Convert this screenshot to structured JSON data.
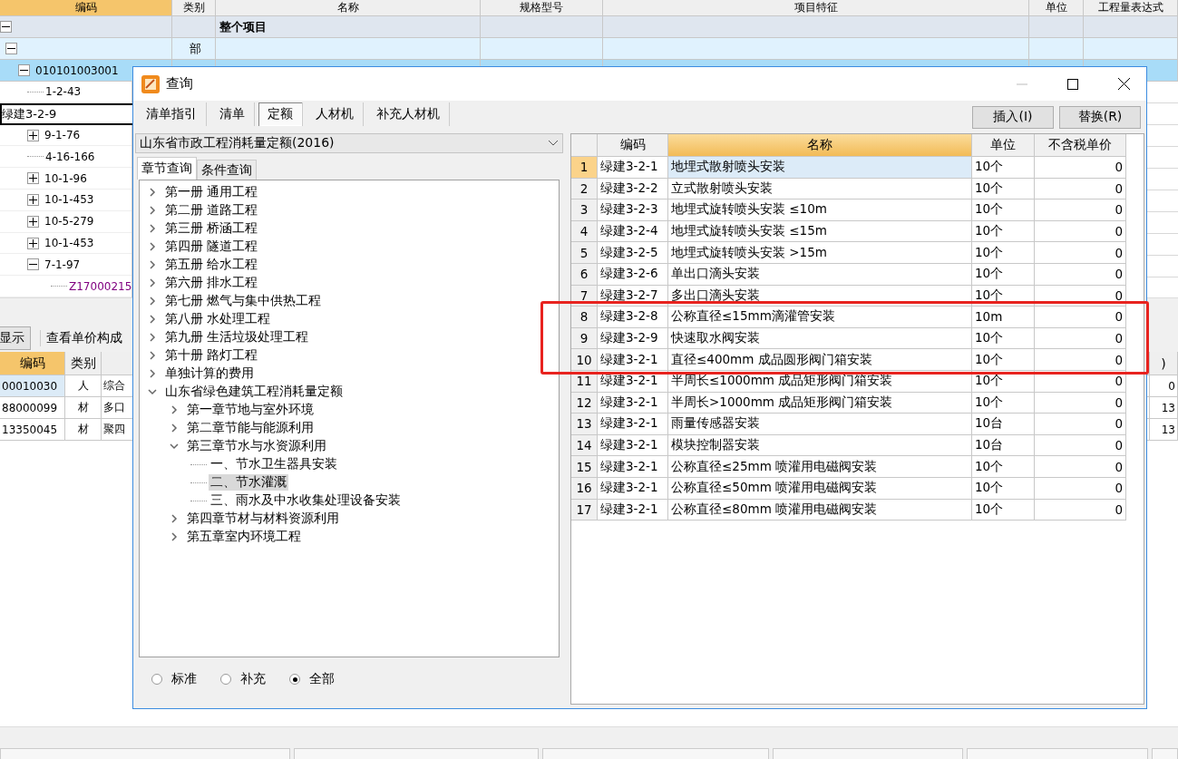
{
  "main_table": {
    "columns": [
      "编码",
      "类别",
      "名称",
      "规格型号",
      "项目特征",
      "单位",
      "工程量表达式"
    ],
    "rows": [
      {
        "kind": "project",
        "name": "整个项目",
        "expanded": true,
        "selected": false
      },
      {
        "kind": "part",
        "type": "部",
        "expanded": true,
        "selected": false
      },
      {
        "kind": "item",
        "code": "010101003001",
        "expanded": true,
        "selected": true
      }
    ]
  },
  "tree_rows": [
    {
      "kind": "leaf",
      "code": "1-2-43",
      "color": "#000000"
    },
    {
      "kind": "editing",
      "code": "绿建3-2-9",
      "color": "#000000"
    },
    {
      "kind": "group",
      "code": "9-1-76",
      "expanded": false,
      "color": "#000000"
    },
    {
      "kind": "leaf",
      "code": "4-16-166",
      "color": "#000000"
    },
    {
      "kind": "group",
      "code": "10-1-96",
      "expanded": false,
      "color": "#000000"
    },
    {
      "kind": "group",
      "code": "10-1-453",
      "expanded": false,
      "color": "#000000"
    },
    {
      "kind": "group",
      "code": "10-5-279",
      "expanded": false,
      "color": "#000000"
    },
    {
      "kind": "group",
      "code": "10-1-453",
      "expanded": false,
      "color": "#000000"
    },
    {
      "kind": "group",
      "code": "7-1-97",
      "expanded": true,
      "color": "#000000"
    },
    {
      "kind": "subleaf",
      "code": "Z17000215",
      "color": "#800080"
    }
  ],
  "lower_toolbar": {
    "buttons": [
      "显示",
      "查看单价构成"
    ]
  },
  "lower_table": {
    "columns": [
      "编码",
      "类别",
      "",
      ")"
    ],
    "rows": [
      {
        "code": "00010030",
        "type": "人",
        "name": "综合",
        "value": "0",
        "selected": true
      },
      {
        "code": "88000099",
        "type": "材",
        "name": "多口",
        "value": "13",
        "selected": false
      },
      {
        "code": "13350045",
        "type": "材",
        "name": "聚四",
        "value": "13",
        "selected": false
      }
    ]
  },
  "dialog": {
    "title": "查询",
    "tabs": [
      {
        "label": "清单指引",
        "selected": false
      },
      {
        "label": "清单",
        "selected": false
      },
      {
        "label": "定额",
        "selected": true
      },
      {
        "label": "人材机",
        "selected": false
      },
      {
        "label": "补充人材机",
        "selected": false
      }
    ],
    "buttons": [
      "插入(I)",
      "替换(R)"
    ],
    "library": "山东省市政工程消耗量定额(2016)",
    "query_tabs": [
      {
        "label": "章节查询",
        "selected": true
      },
      {
        "label": "条件查询",
        "selected": false
      }
    ],
    "tree": [
      {
        "label": "第一册 通用工程",
        "expanded": false,
        "selected": false
      },
      {
        "label": "第二册 道路工程",
        "expanded": false,
        "selected": false
      },
      {
        "label": "第三册 桥涵工程",
        "expanded": false,
        "selected": false
      },
      {
        "label": "第四册 隧道工程",
        "expanded": false,
        "selected": false
      },
      {
        "label": "第五册 给水工程",
        "expanded": false,
        "selected": false
      },
      {
        "label": "第六册 排水工程",
        "expanded": false,
        "selected": false
      },
      {
        "label": "第七册 燃气与集中供热工程",
        "expanded": false,
        "selected": false
      },
      {
        "label": "第八册 水处理工程",
        "expanded": false,
        "selected": false
      },
      {
        "label": "第九册 生活垃圾处理工程",
        "expanded": false,
        "selected": false
      },
      {
        "label": "第十册 路灯工程",
        "expanded": false,
        "selected": false
      },
      {
        "label": "单独计算的费用",
        "expanded": false,
        "selected": false
      },
      {
        "label": "山东省绿色建筑工程消耗量定额",
        "expanded": true,
        "selected": false,
        "children": [
          {
            "label": "第一章节地与室外环境",
            "expanded": false,
            "selected": false
          },
          {
            "label": "第二章节能与能源利用",
            "expanded": false,
            "selected": false
          },
          {
            "label": "第三章节水与水资源利用",
            "expanded": true,
            "selected": false,
            "children": [
              {
                "label": "一、节水卫生器具安装",
                "selected": false
              },
              {
                "label": "二、节水灌溉",
                "selected": true
              },
              {
                "label": "三、雨水及中水收集处理设备安装",
                "selected": false
              }
            ]
          },
          {
            "label": "第四章节材与材料资源利用",
            "expanded": false,
            "selected": false
          },
          {
            "label": "第五章室内环境工程",
            "expanded": false,
            "selected": false
          }
        ]
      }
    ],
    "filters": [
      {
        "label": "标准",
        "selected": false
      },
      {
        "label": "补充",
        "selected": false
      },
      {
        "label": "全部",
        "selected": true
      }
    ],
    "table": {
      "columns": [
        "编码",
        "名称",
        "单位",
        "不含税单价"
      ],
      "rows": [
        {
          "no": "1",
          "code": "绿建3-2-1",
          "name": "地埋式散射喷头安装",
          "unit": "10个",
          "price": "0",
          "selected": true,
          "highlighted": false
        },
        {
          "no": "2",
          "code": "绿建3-2-2",
          "name": "立式散射喷头安装",
          "unit": "10个",
          "price": "0",
          "selected": false,
          "highlighted": false
        },
        {
          "no": "3",
          "code": "绿建3-2-3",
          "name": "地埋式旋转喷头安装 ≤10m",
          "unit": "10个",
          "price": "0",
          "selected": false,
          "highlighted": false
        },
        {
          "no": "4",
          "code": "绿建3-2-4",
          "name": "地埋式旋转喷头安装 ≤15m",
          "unit": "10个",
          "price": "0",
          "selected": false,
          "highlighted": false
        },
        {
          "no": "5",
          "code": "绿建3-2-5",
          "name": "地埋式旋转喷头安装 >15m",
          "unit": "10个",
          "price": "0",
          "selected": false,
          "highlighted": false
        },
        {
          "no": "6",
          "code": "绿建3-2-6",
          "name": "单出口滴头安装",
          "unit": "10个",
          "price": "0",
          "selected": false,
          "highlighted": false
        },
        {
          "no": "7",
          "code": "绿建3-2-7",
          "name": "多出口滴头安装",
          "unit": "10个",
          "price": "0",
          "selected": false,
          "highlighted": false
        },
        {
          "no": "8",
          "code": "绿建3-2-8",
          "name": "公称直径≤15mm滴灌管安装",
          "unit": "10m",
          "price": "0",
          "selected": false,
          "highlighted": true
        },
        {
          "no": "9",
          "code": "绿建3-2-9",
          "name": "快速取水阀安装",
          "unit": "10个",
          "price": "0",
          "selected": false,
          "highlighted": true
        },
        {
          "no": "10",
          "code": "绿建3-2-1",
          "name": "直径≤400mm 成品圆形阀门箱安装",
          "unit": "10个",
          "price": "0",
          "selected": false,
          "highlighted": true
        },
        {
          "no": "11",
          "code": "绿建3-2-1",
          "name": "半周长≤1000mm 成品矩形阀门箱安装",
          "unit": "10个",
          "price": "0",
          "selected": false,
          "highlighted": false
        },
        {
          "no": "12",
          "code": "绿建3-2-1",
          "name": "半周长>1000mm 成品矩形阀门箱安装",
          "unit": "10个",
          "price": "0",
          "selected": false,
          "highlighted": false
        },
        {
          "no": "13",
          "code": "绿建3-2-1",
          "name": "雨量传感器安装",
          "unit": "10台",
          "price": "0",
          "selected": false,
          "highlighted": false
        },
        {
          "no": "14",
          "code": "绿建3-2-1",
          "name": "模块控制器安装",
          "unit": "10台",
          "price": "0",
          "selected": false,
          "highlighted": false
        },
        {
          "no": "15",
          "code": "绿建3-2-1",
          "name": "公称直径≤25mm 喷灌用电磁阀安装",
          "unit": "10个",
          "price": "0",
          "selected": false,
          "highlighted": false
        },
        {
          "no": "16",
          "code": "绿建3-2-1",
          "name": "公称直径≤50mm 喷灌用电磁阀安装",
          "unit": "10个",
          "price": "0",
          "selected": false,
          "highlighted": false
        },
        {
          "no": "17",
          "code": "绿建3-2-1",
          "name": "公称直径≤80mm 喷灌用电磁阀安装",
          "unit": "10个",
          "price": "0",
          "selected": false,
          "highlighted": false
        }
      ]
    }
  }
}
